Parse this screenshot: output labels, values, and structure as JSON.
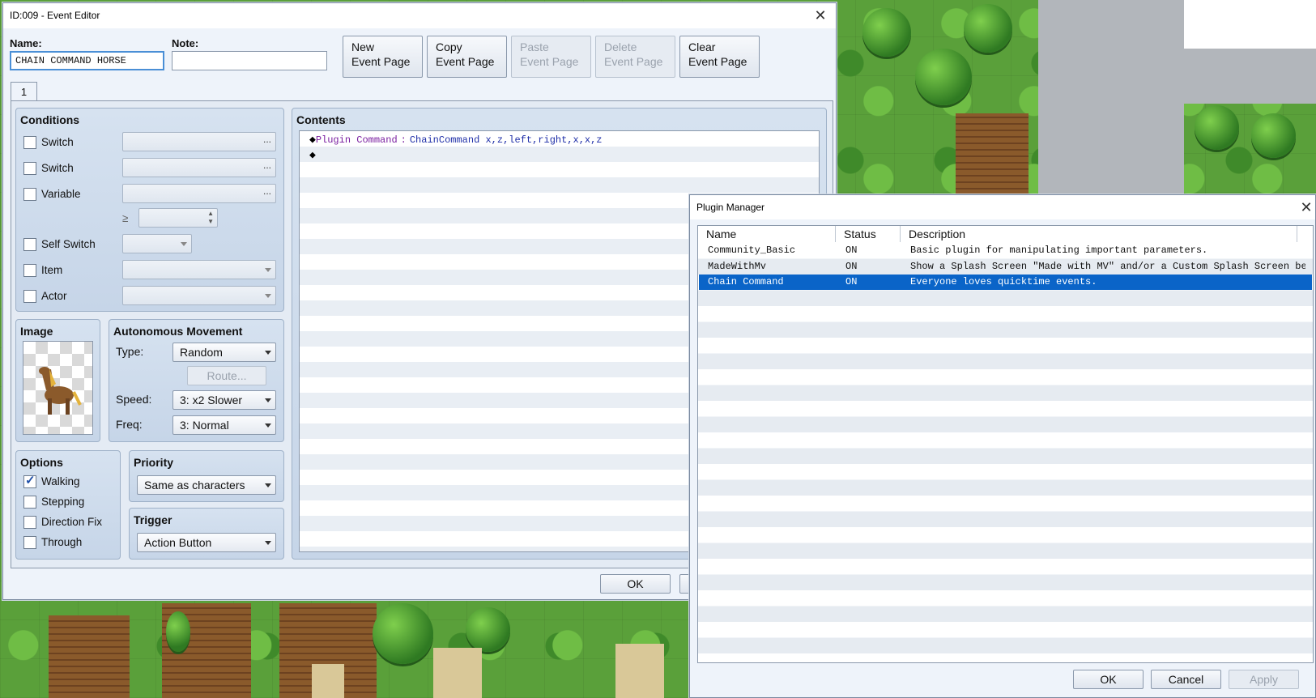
{
  "event_editor": {
    "title": "ID:009 - Event Editor",
    "name_label": "Name:",
    "name_value": "CHAIN COMMAND HORSE",
    "note_label": "Note:",
    "note_value": "",
    "buttons": {
      "new_page": [
        "New",
        "Event Page"
      ],
      "copy_page": [
        "Copy",
        "Event Page"
      ],
      "paste_page": [
        "Paste",
        "Event Page"
      ],
      "delete_page": [
        "Delete",
        "Event Page"
      ],
      "clear_page": [
        "Clear",
        "Event Page"
      ]
    },
    "tab": "1",
    "conditions": {
      "title": "Conditions",
      "switch1": "Switch",
      "switch2": "Switch",
      "variable": "Variable",
      "gte": "≥",
      "self_switch": "Self Switch",
      "item": "Item",
      "actor": "Actor",
      "ellipsis": "..."
    },
    "image": {
      "title": "Image"
    },
    "movement": {
      "title": "Autonomous Movement",
      "type_label": "Type:",
      "type_value": "Random",
      "route_button": "Route...",
      "speed_label": "Speed:",
      "speed_value": "3: x2 Slower",
      "freq_label": "Freq:",
      "freq_value": "3: Normal"
    },
    "options": {
      "title": "Options",
      "walking": "Walking",
      "walking_checked": true,
      "stepping": "Stepping",
      "direction_fix": "Direction Fix",
      "through": "Through"
    },
    "priority": {
      "title": "Priority",
      "value": "Same as characters"
    },
    "trigger": {
      "title": "Trigger",
      "value": "Action Button"
    },
    "contents": {
      "title": "Contents",
      "line1_marker": "◆",
      "line1_command": "Plugin Command",
      "line1_sep": ":",
      "line1_args": "ChainCommand x,z,left,right,x,x,z",
      "line2_marker": "◆"
    },
    "ok": "OK"
  },
  "plugin_manager": {
    "title": "Plugin Manager",
    "columns": [
      "Name",
      "Status",
      "Description"
    ],
    "rows": [
      {
        "name": "Community_Basic",
        "status": "ON",
        "description": "Basic plugin for manipulating important parameters."
      },
      {
        "name": "MadeWithMv",
        "status": "ON",
        "description": "Show a Splash Screen \"Made with MV\" and/or a Custom Splash Screen be…"
      },
      {
        "name": "Chain Command",
        "status": "ON",
        "description": "Everyone loves quicktime events."
      }
    ],
    "selected_row": 2,
    "ok": "OK",
    "cancel": "Cancel",
    "apply": "Apply"
  },
  "colors": {
    "selection": "#0a64c8",
    "plugin_command": "#7a1fa0",
    "plugin_args": "#1f2fa8"
  }
}
